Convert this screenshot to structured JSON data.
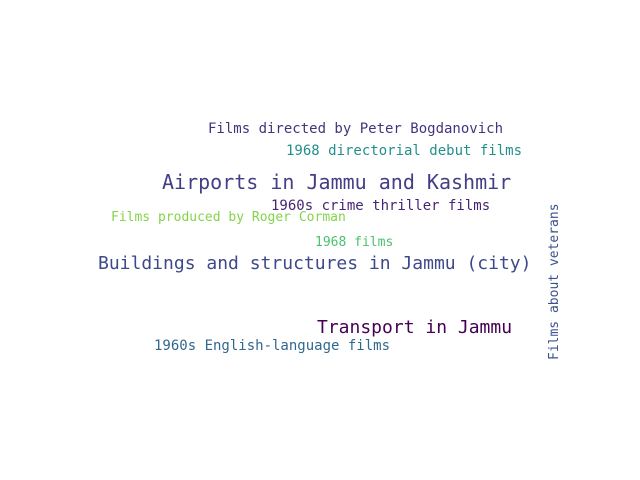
{
  "word_cloud": {
    "words": [
      {
        "id": "bogdanovich",
        "text": "Films directed by Peter Bogdanovich",
        "color": "#46337e"
      },
      {
        "id": "directorial",
        "text": "1968 directorial debut films",
        "color": "#21908d"
      },
      {
        "id": "airports",
        "text": "Airports in Jammu and Kashmir",
        "color": "#433e85"
      },
      {
        "id": "crime",
        "text": "1960s crime thriller films",
        "color": "#482475"
      },
      {
        "id": "corman",
        "text": "Films produced by Roger Corman",
        "color": "#84d44b"
      },
      {
        "id": "films1968",
        "text": "1968 films",
        "color": "#4ac16d"
      },
      {
        "id": "buildings",
        "text": "Buildings and structures in Jammu (city)",
        "color": "#3e4989"
      },
      {
        "id": "transport",
        "text": "Transport in Jammu",
        "color": "#440154"
      },
      {
        "id": "english",
        "text": "1960s English-language films",
        "color": "#31688e"
      },
      {
        "id": "veterans",
        "text": "Films about veterans",
        "color": "#3b528b",
        "orientation": "vertical"
      }
    ]
  }
}
